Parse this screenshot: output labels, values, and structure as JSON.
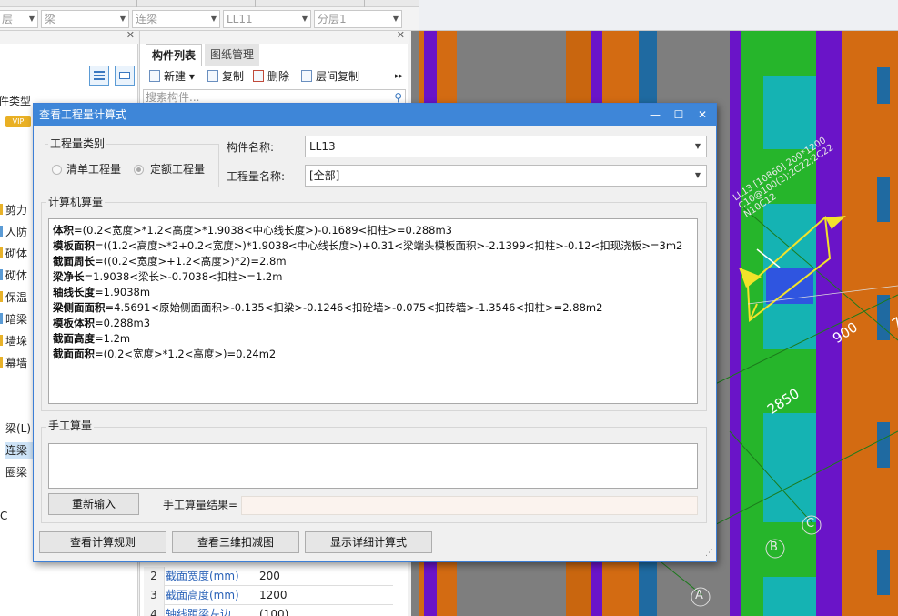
{
  "filter": {
    "floor": "层",
    "category": "梁",
    "type": "连梁",
    "name": "LL11",
    "layer": "分层1"
  },
  "left_panel": {
    "header": "件类型",
    "vip_badge": "VIP",
    "items": [
      "剪力",
      "人防",
      "砌体",
      "砌体",
      "保温",
      "暗梁",
      "墙垛",
      "幕墙",
      "梁(L)",
      "连梁",
      "圈梁",
      "C"
    ]
  },
  "component_panel": {
    "tabs": [
      "构件列表",
      "图纸管理"
    ],
    "tools": {
      "new": "新建",
      "copy": "复制",
      "delete": "删除",
      "floor_copy": "层间复制"
    },
    "search_placeholder": "搜索构件...",
    "props": [
      {
        "n": "2",
        "k": "截面宽度(mm)",
        "v": "200"
      },
      {
        "n": "3",
        "k": "截面高度(mm)",
        "v": "1200"
      },
      {
        "n": "4",
        "k": "轴线距梁左边",
        "v": "(100)"
      }
    ]
  },
  "viewport": {
    "beam_label_1": "LL13 [10860] 200*1200",
    "beam_label_2": "C10@100(2);2C22;2C22",
    "beam_label_3": "N10C12",
    "dim_1": "900",
    "dim_2": "2850",
    "dim_3": "7",
    "axes": [
      "C",
      "B",
      "A"
    ],
    "colors": {
      "orange": "#d36b12",
      "purple": "#6a14c8",
      "green": "#26b52b",
      "cyan": "#15b3b3",
      "blue": "#2f55e0",
      "gray": "#7d7d7d",
      "yellow": "#f2e32a"
    }
  },
  "dialog": {
    "title": "查看工程量计算式",
    "qty_type_label": "工程量类别",
    "radio_list": "清单工程量",
    "radio_quota": "定额工程量",
    "comp_name_label": "构件名称:",
    "comp_name_value": "LL13",
    "qty_name_label": "工程量名称:",
    "qty_name_value": "[全部]",
    "computer_section": "计算机算量",
    "lines": [
      {
        "k": "体积",
        "v": "=(0.2<宽度>*1.2<高度>*1.9038<中心线长度>)-0.1689<扣柱>=0.288m3"
      },
      {
        "k": "模板面积",
        "v": "=((1.2<高度>*2+0.2<宽度>)*1.9038<中心线长度>)+0.31<梁端头模板面积>-2.1399<扣柱>-0.12<扣现浇板>=3m2"
      },
      {
        "k": "截面周长",
        "v": "=((0.2<宽度>+1.2<高度>)*2)=2.8m"
      },
      {
        "k": "梁净长",
        "v": "=1.9038<梁长>-0.7038<扣柱>=1.2m"
      },
      {
        "k": "轴线长度",
        "v": "=1.9038m"
      },
      {
        "k": "梁侧面面积",
        "v": "=4.5691<原始侧面面积>-0.135<扣梁>-0.1246<扣砼墙>-0.075<扣砖墙>-1.3546<扣柱>=2.88m2"
      },
      {
        "k": "模板体积",
        "v": "=0.288m3"
      },
      {
        "k": "截面高度",
        "v": "=1.2m"
      },
      {
        "k": "截面面积",
        "v": "=(0.2<宽度>*1.2<高度>)=0.24m2"
      }
    ],
    "manual_section": "手工算量",
    "reinput_button": "重新输入",
    "manual_result_label": "手工算量结果=",
    "buttons": {
      "rules": "查看计算规则",
      "view3d": "查看三维扣减图",
      "detail": "显示详细计算式"
    }
  }
}
